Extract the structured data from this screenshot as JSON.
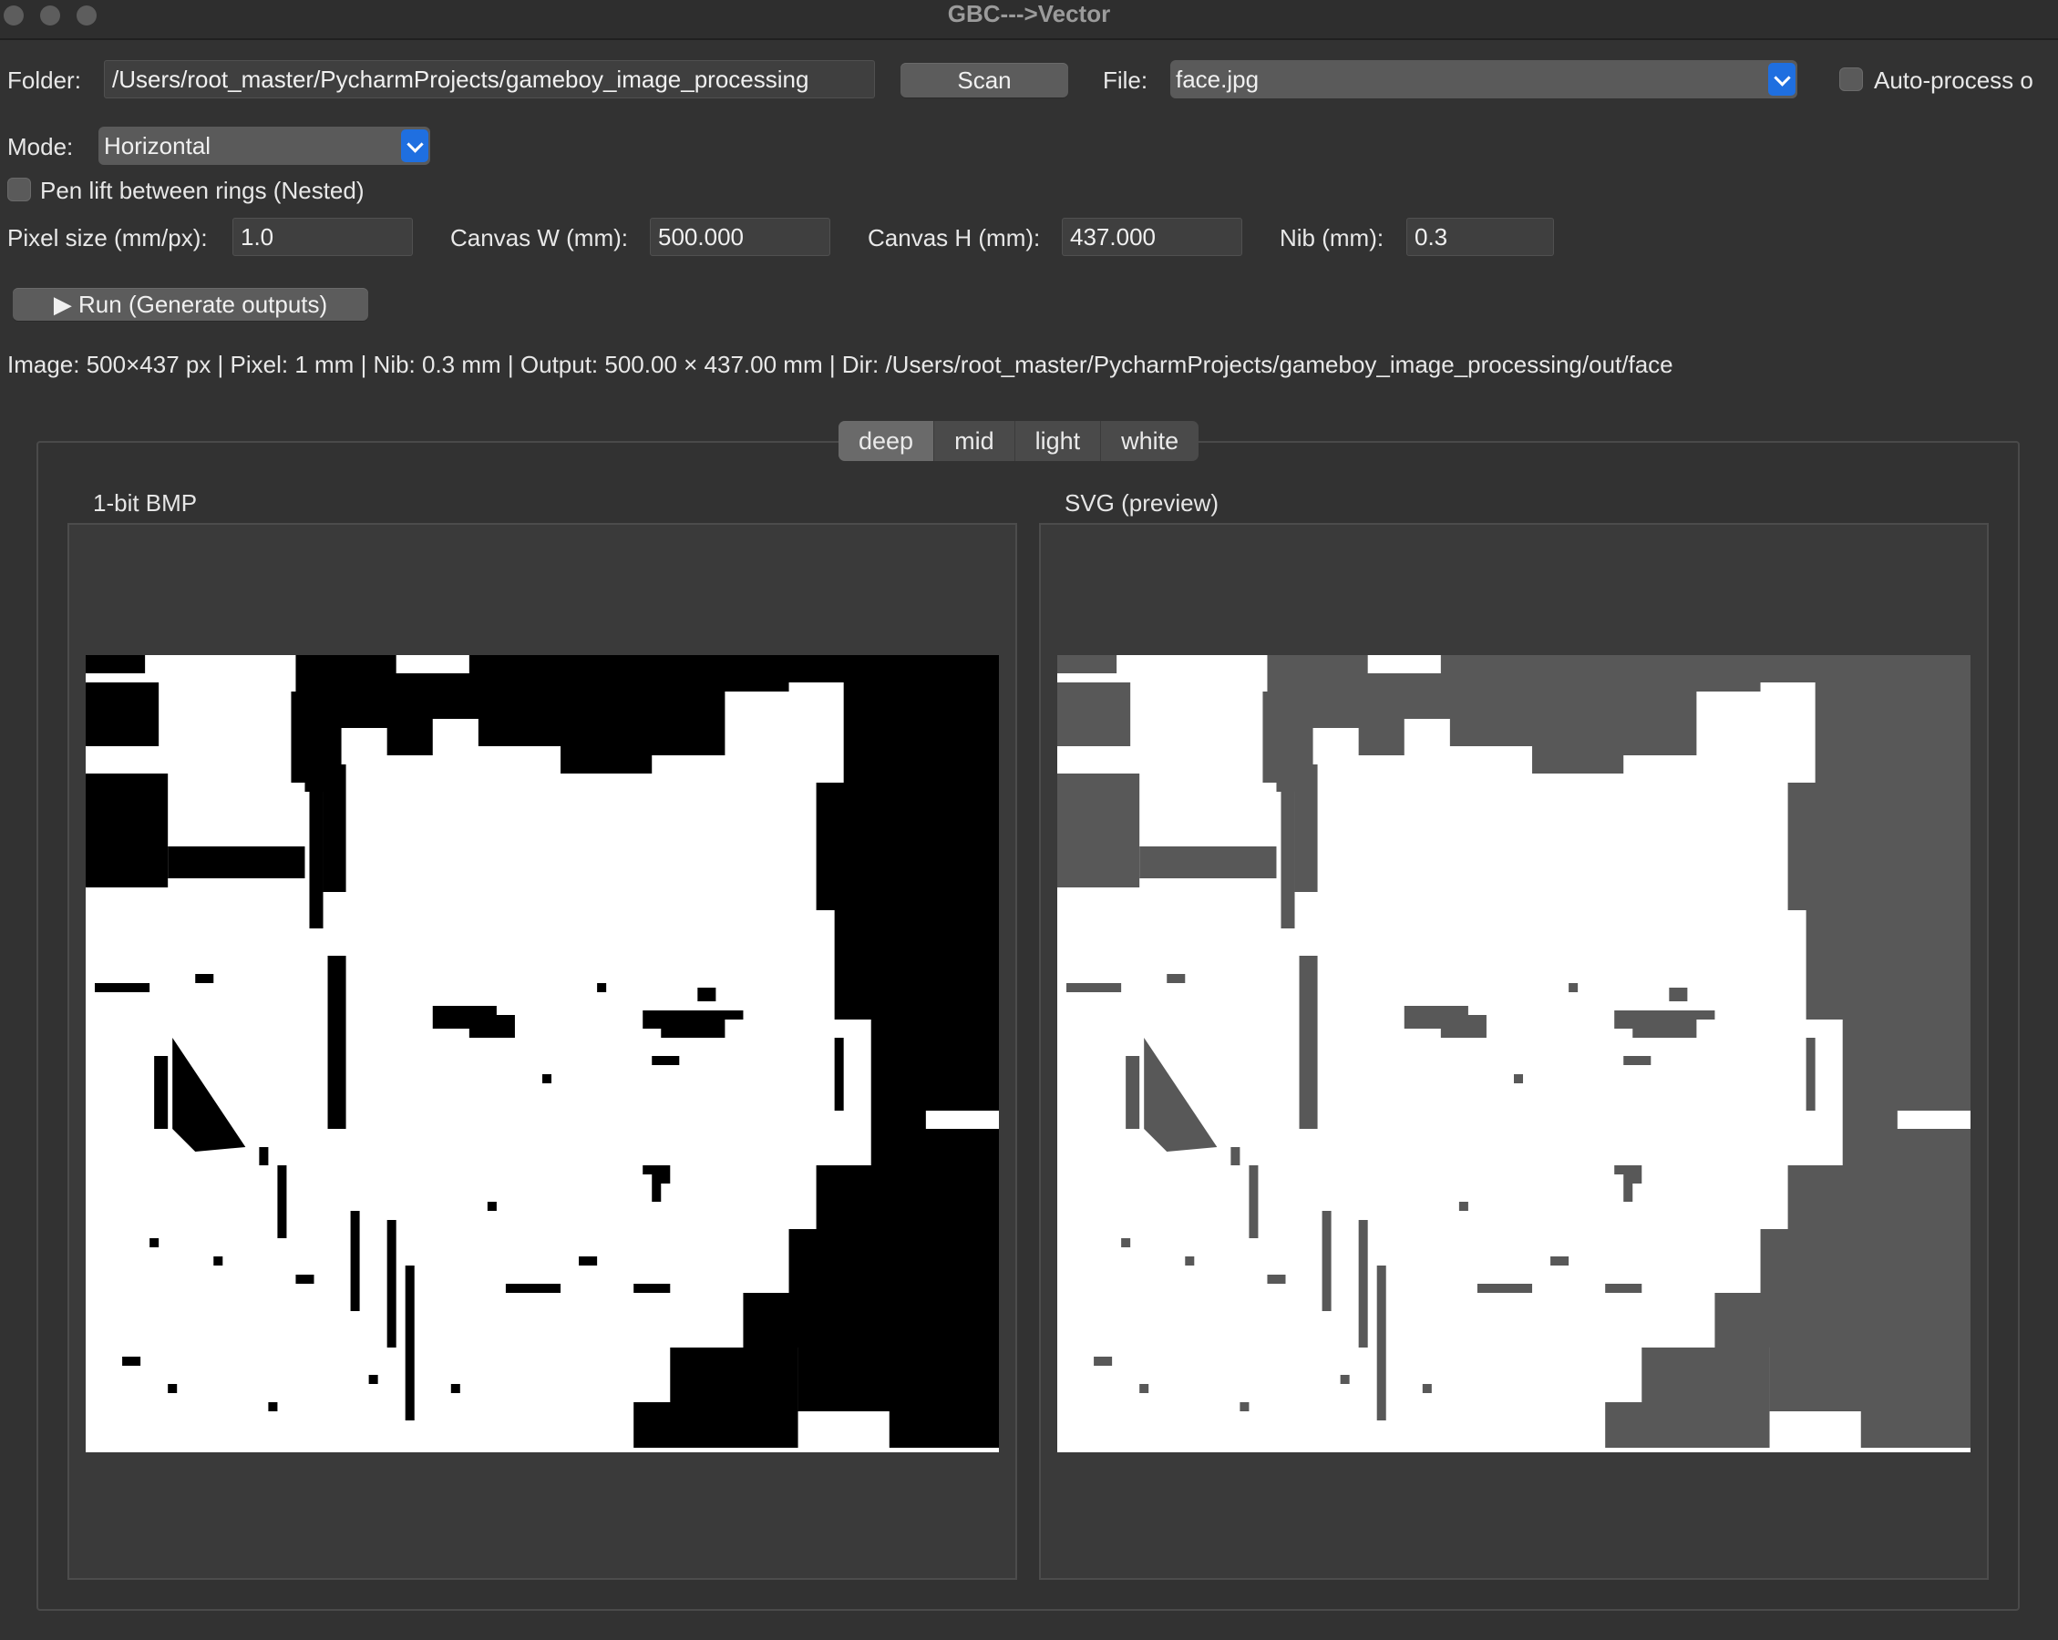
{
  "window": {
    "title": "GBC--->Vector"
  },
  "folder": {
    "label": "Folder:",
    "value": "/Users/root_master/PycharmProjects/gameboy_image_processing"
  },
  "scan": {
    "label": "Scan"
  },
  "file": {
    "label": "File:",
    "value": "face.jpg"
  },
  "auto_process": {
    "label": "Auto-process o",
    "checked": false
  },
  "mode": {
    "label": "Mode:",
    "value": "Horizontal"
  },
  "pen_lift": {
    "label": "Pen lift between rings (Nested)",
    "checked": false
  },
  "params": {
    "pixel_size_label": "Pixel size (mm/px):",
    "pixel_size": "1.0",
    "canvas_w_label": "Canvas W (mm):",
    "canvas_w": "500.000",
    "canvas_h_label": "Canvas H (mm):",
    "canvas_h": "437.000",
    "nib_label": "Nib (mm):",
    "nib": "0.3"
  },
  "run": {
    "label": "▶ Run (Generate outputs)"
  },
  "status": {
    "text": "Image: 500×437 px  |  Pixel: 1 mm  |  Nib: 0.3 mm  |  Output: 500.00 × 437.00 mm  |  Dir: /Users/root_master/PycharmProjects/gameboy_image_processing/out/face"
  },
  "tabs": [
    {
      "label": "deep",
      "active": true
    },
    {
      "label": "mid",
      "active": false
    },
    {
      "label": "light",
      "active": false
    },
    {
      "label": "white",
      "active": false
    }
  ],
  "panels": {
    "bmp": {
      "title": "1-bit BMP",
      "ink_color": "#000000"
    },
    "svg": {
      "title": "SVG (preview)",
      "ink_color": "#585858"
    }
  },
  "colors": {
    "accent": "#1f6fe0",
    "background": "#323232"
  }
}
